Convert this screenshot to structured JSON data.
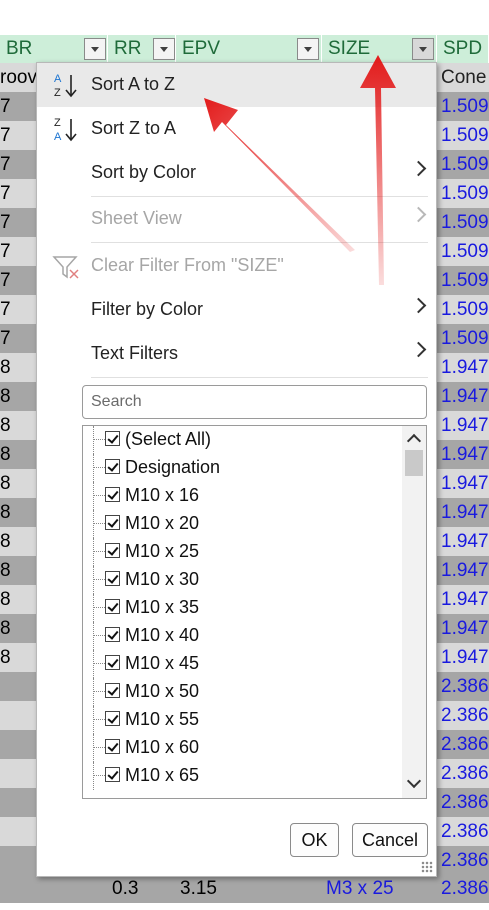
{
  "headers": [
    {
      "label": "BR",
      "name": "col-br"
    },
    {
      "label": "RR",
      "name": "col-rr"
    },
    {
      "label": "EPV",
      "name": "col-epv"
    },
    {
      "label": "SIZE",
      "name": "col-size"
    },
    {
      "label": "SPD",
      "name": "col-spd"
    }
  ],
  "row_first": {
    "br": "roov",
    "spd": "Cone"
  },
  "rows": [
    {
      "br": "7",
      "spd": "1.509"
    },
    {
      "br": "7",
      "spd": "1.509"
    },
    {
      "br": "7",
      "spd": "1.509"
    },
    {
      "br": "7",
      "spd": "1.509"
    },
    {
      "br": "7",
      "spd": "1.509"
    },
    {
      "br": "7",
      "spd": "1.509"
    },
    {
      "br": "7",
      "spd": "1.509"
    },
    {
      "br": "7",
      "spd": "1.509"
    },
    {
      "br": "7",
      "spd": "1.509"
    },
    {
      "br": "8",
      "spd": "1.947"
    },
    {
      "br": "8",
      "spd": "1.947"
    },
    {
      "br": "8",
      "spd": "1.947"
    },
    {
      "br": "8",
      "spd": "1.947"
    },
    {
      "br": "8",
      "spd": "1.947"
    },
    {
      "br": "8",
      "spd": "1.947"
    },
    {
      "br": "8",
      "spd": "1.947"
    },
    {
      "br": "8",
      "spd": "1.947"
    },
    {
      "br": "8",
      "spd": "1.947"
    },
    {
      "br": "8",
      "spd": "1.947"
    },
    {
      "br": "8",
      "spd": "1.947"
    },
    {
      "br": "",
      "spd": "2.386"
    },
    {
      "br": "",
      "spd": "2.386"
    },
    {
      "br": "",
      "spd": "2.386"
    },
    {
      "br": "",
      "spd": "2.386"
    },
    {
      "br": "",
      "spd": "2.386"
    },
    {
      "br": "",
      "spd": "2.386"
    },
    {
      "br": "",
      "spd": "2.386"
    }
  ],
  "last_row": {
    "rr": "0.3",
    "epv": "3.15",
    "size": "M3 x 25",
    "spd": "2.386"
  },
  "menu": {
    "sort_az": "Sort A to Z",
    "sort_za": "Sort Z to A",
    "sort_by_color": "Sort by Color",
    "sheet_view": "Sheet View",
    "clear_filter": "Clear Filter From \"SIZE\"",
    "filter_by_color": "Filter by Color",
    "text_filters": "Text Filters"
  },
  "search": {
    "placeholder": "Search"
  },
  "list_items": [
    "(Select All)",
    "Designation",
    "M10 x 16",
    "M10 x 20",
    "M10 x 25",
    "M10 x 30",
    "M10 x 35",
    "M10 x 40",
    "M10 x 45",
    "M10 x 50",
    "M10 x 55",
    "M10 x 60",
    "M10 x 65"
  ],
  "buttons": {
    "ok": "OK",
    "cancel": "Cancel"
  },
  "colors": {
    "header_bg": "#cdeed9",
    "header_text": "#1f6b3a",
    "row_dark": "#a6a6a6",
    "row_light": "#d9d9d9",
    "value_blue": "#1a1adf",
    "annotation_arrow": "#e31b1b"
  }
}
